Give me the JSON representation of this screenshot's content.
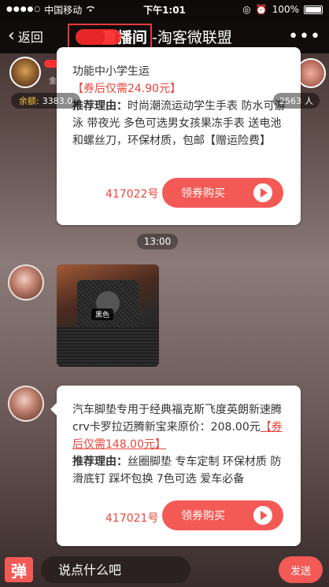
{
  "status_bar": {
    "carrier": "中国移动",
    "time": "下午1:01",
    "battery": "100%"
  },
  "nav": {
    "back_label": "返回",
    "title_part1": "直播间",
    "title_part2": "-淘客微联盟"
  },
  "host": {
    "sub": "金华"
  },
  "balance": {
    "label": "余额:",
    "value": "3383.0"
  },
  "viewers": {
    "count": "2563",
    "unit": "人"
  },
  "card_top": {
    "line1": "功能中小学生运",
    "price": "【券后仅需24.90元】",
    "reason_label": "推荐理由：",
    "reason_text": "时尚潮流运动学生手表 防水可游泳 带夜光 多色可选男女孩果冻手表  送电池和螺丝刀，环保材质，包邮【赠运险费】",
    "order_num": "417022号",
    "buy_label": "领券购买"
  },
  "time_divider": "13:00",
  "photo_msg": {
    "tag": "黑色"
  },
  "card_bottom": {
    "desc": "汽车脚垫专用于经典福克斯飞度英朗新速腾crv卡罗拉迈腾新宝来原价：208.00元",
    "price": "【券后仅需148.00元】",
    "reason_label": "推荐理由：",
    "reason_text": "丝圈脚垫 专车定制 环保材质 防滑底钉 踩坏包换 7色可选 爱车必备",
    "order_num": "417021号",
    "buy_label": "领券购买"
  },
  "bottom": {
    "danmu_label": "弹",
    "input_placeholder": "说点什么吧",
    "send_label": "发送"
  },
  "colors": {
    "accent": "#f45a55",
    "price": "#e8463b",
    "title_border": "#e83a3a"
  }
}
